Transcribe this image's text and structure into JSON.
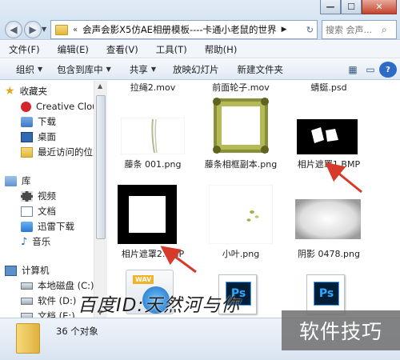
{
  "window": {
    "min_glyph": "—",
    "max_glyph": "☐",
    "close_glyph": "✕"
  },
  "nav": {
    "back_glyph": "◀",
    "forward_glyph": "▶",
    "dropdown_glyph": "▼"
  },
  "address": {
    "sep": "«",
    "path": "会声会影X5仿AE相册模板----卡通小老鼠的世界",
    "arrow": "▶",
    "refresh": "↻"
  },
  "search": {
    "placeholder": "搜索 会声..."
  },
  "menu": [
    "文件(F)",
    "编辑(E)",
    "查看(V)",
    "工具(T)",
    "帮助(H)"
  ],
  "toolbar": {
    "organize": "组织",
    "include_library": "包含到库中",
    "share": "共享",
    "slideshow": "放映幻灯片",
    "new_folder": "新建文件夹",
    "caret": "▼"
  },
  "sidebar": {
    "favorites": "收藏夹",
    "creative_cloud": "Creative Clouc",
    "downloads": "下载",
    "desktop": "桌面",
    "recent": "最近访问的位置",
    "libraries": "库",
    "videos": "视频",
    "documents": "文档",
    "xunlei": "迅雷下载",
    "music": "音乐",
    "computer": "计算机",
    "local_c": "本地磁盘 (C:)",
    "soft_d": "软件 (D:)",
    "docs_e": "文档 (E:)"
  },
  "files": {
    "top_row": [
      "拉绳2.mov",
      "前面轮子.mov",
      "蜻蜓.psd"
    ],
    "row2": [
      "藤条 001.png",
      "藤条相框副本.png",
      "相片遮罩1.BMP"
    ],
    "row3": [
      "相片遮罩2.BMP",
      "小叶.png",
      "阴影 0478.png"
    ],
    "row4_wav_badge": "WAV",
    "ps_badge": "Ps"
  },
  "status": {
    "count_text": "36 个对象"
  },
  "watermark": {
    "baidu": "百度ID:天然河与你",
    "jiqiao": "软件技巧"
  },
  "colors": {
    "arrow": "#d63a2a",
    "ps_blue": "#31a8ff",
    "ps_bg": "#001e36"
  }
}
